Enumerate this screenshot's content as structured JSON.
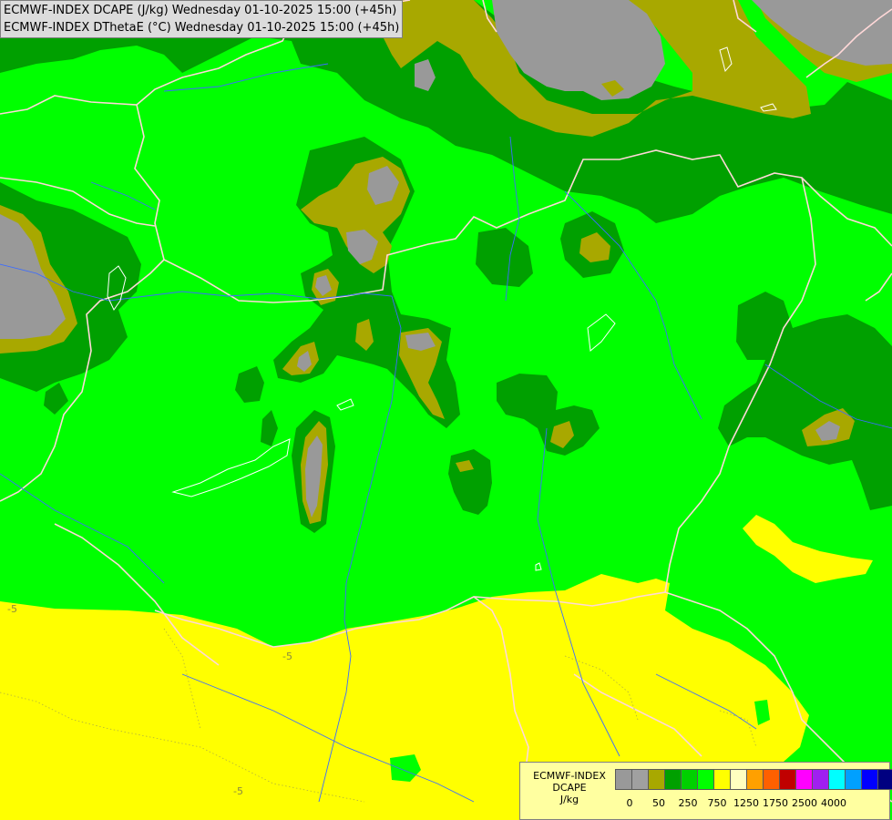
{
  "header": {
    "line1": "ECMWF-INDEX DCAPE (J/kg) Wednesday 01-10-2025 15:00 (+45h)",
    "line2": "ECMWF-INDEX DThetaE (°C) Wednesday 01-10-2025 15:00 (+45h)"
  },
  "map": {
    "contour_label": "-5",
    "fill_colors": {
      "gray": "#999999",
      "olive": "#a8a800",
      "dark_green": "#00a000",
      "green": "#00ff00",
      "yellow": "#ffff00"
    },
    "border_color": "#ffd8d8",
    "river_color": "#3c6cff"
  },
  "legend": {
    "title_lines": [
      "ECMWF-INDEX",
      "DCAPE",
      "J/kg"
    ],
    "colors": [
      "#999999",
      "#a0a0a0",
      "#a8a800",
      "#00a000",
      "#00d000",
      "#00ff00",
      "#ffff00",
      "#ffffc0",
      "#ffa000",
      "#ff6000",
      "#c00000",
      "#ff00ff",
      "#a020f0",
      "#00ffff",
      "#00a0ff",
      "#0000ff",
      "#000080"
    ],
    "tick_labels": [
      "0",
      "50",
      "250",
      "750",
      "1250",
      "1750",
      "2500",
      "4000"
    ]
  }
}
